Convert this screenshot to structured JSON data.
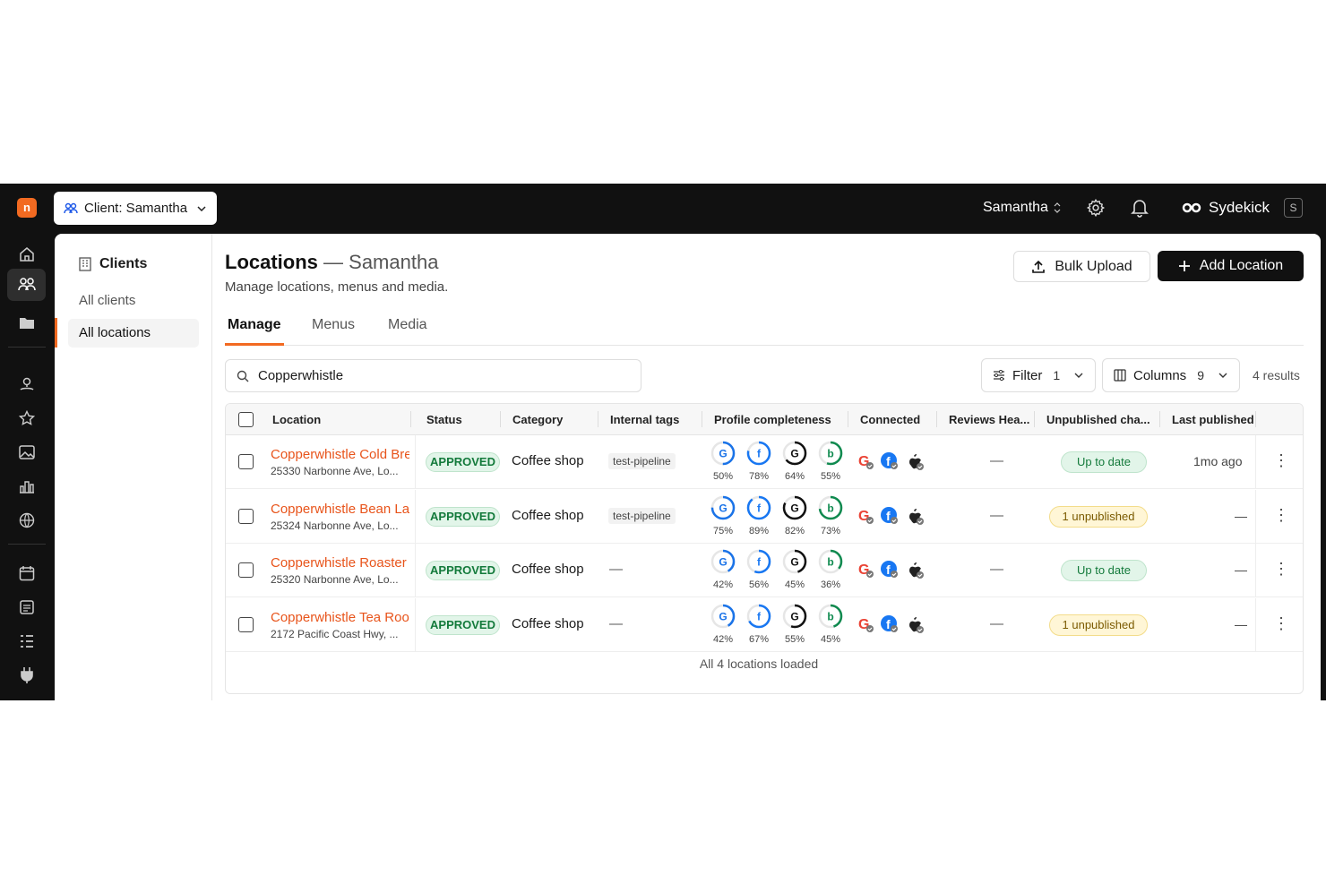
{
  "client_selector": {
    "label": "Client: Samantha"
  },
  "topbar": {
    "user": "Samantha",
    "assistant": "Sydekick",
    "shortcut": "S"
  },
  "sidebar": {
    "title": "Clients",
    "items": [
      {
        "label": "All clients"
      },
      {
        "label": "All locations"
      }
    ]
  },
  "page": {
    "title": "Locations",
    "title_suffix": "— Samantha",
    "description": "Manage locations, menus and media.",
    "bulk_upload": "Bulk Upload",
    "add_location": "Add Location"
  },
  "tabs": [
    {
      "label": "Manage"
    },
    {
      "label": "Menus"
    },
    {
      "label": "Media"
    }
  ],
  "toolbar": {
    "search_value": "Copperwhistle",
    "filter_label": "Filter",
    "filter_count": "1",
    "columns_label": "Columns",
    "columns_count": "9",
    "results": "4 results"
  },
  "table": {
    "headers": [
      "Location",
      "Status",
      "Category",
      "Internal tags",
      "Profile completeness",
      "Connected",
      "Reviews Hea...",
      "Unpublished cha...",
      "Last published"
    ],
    "rows": [
      {
        "name": "Copperwhistle Cold Bre",
        "address": "25330 Narbonne Ave, Lo...",
        "status": "APPROVED",
        "category": "Coffee shop",
        "tag": "test-pipeline",
        "completeness": {
          "google": "50%",
          "facebook": "78%",
          "google2": "64%",
          "bing": "55%"
        },
        "reviews": "—",
        "unpublished": "Up to date",
        "last_published": "1mo ago"
      },
      {
        "name": "Copperwhistle Bean La",
        "address": "25324 Narbonne Ave, Lo...",
        "status": "APPROVED",
        "category": "Coffee shop",
        "tag": "test-pipeline",
        "completeness": {
          "google": "75%",
          "facebook": "89%",
          "google2": "82%",
          "bing": "73%"
        },
        "reviews": "—",
        "unpublished": "1 unpublished",
        "last_published": "—"
      },
      {
        "name": "Copperwhistle Roaster",
        "address": "25320 Narbonne Ave, Lo...",
        "status": "APPROVED",
        "category": "Coffee shop",
        "tag": "—",
        "completeness": {
          "google": "42%",
          "facebook": "56%",
          "google2": "45%",
          "bing": "36%"
        },
        "reviews": "—",
        "unpublished": "Up to date",
        "last_published": "—"
      },
      {
        "name": "Copperwhistle Tea Roo",
        "address": "2172 Pacific Coast Hwy, ...",
        "status": "APPROVED",
        "category": "Coffee shop",
        "tag": "—",
        "completeness": {
          "google": "42%",
          "facebook": "67%",
          "google2": "55%",
          "bing": "45%"
        },
        "reviews": "—",
        "unpublished": "1 unpublished",
        "last_published": "—"
      }
    ],
    "footer": "All 4 locations loaded"
  },
  "colors": {
    "accent": "#f26a21",
    "google": "#1a73e8",
    "facebook": "#1877f2",
    "google2": "#111111",
    "bing": "#0f8a4f"
  }
}
